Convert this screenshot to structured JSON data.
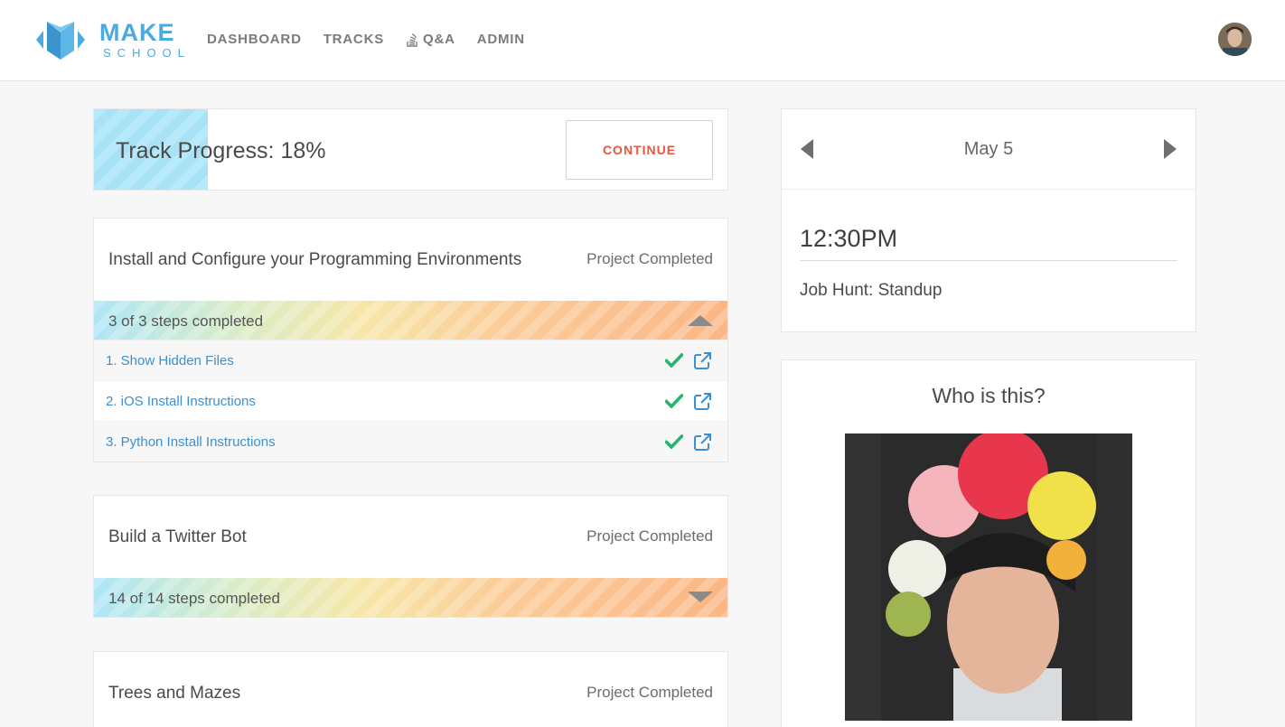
{
  "brand": {
    "make": "MAKE",
    "school": "SCHOOL",
    "color": "#4ea9dd"
  },
  "nav": {
    "items": [
      {
        "label": "DASHBOARD"
      },
      {
        "label": "TRACKS"
      },
      {
        "label": "Q&A",
        "icon": "stack-icon"
      },
      {
        "label": "ADMIN"
      }
    ]
  },
  "progress": {
    "label": "Track Progress: 18%",
    "percent": 18,
    "button": "CONTINUE"
  },
  "projects": [
    {
      "title": "Install and Configure your Programming Environments",
      "status": "Project Completed",
      "steps_text": "3 of 3 steps completed",
      "expanded": true,
      "steps": [
        {
          "label": "1. Show Hidden Files"
        },
        {
          "label": "2. iOS Install Instructions"
        },
        {
          "label": "3. Python Install Instructions"
        }
      ]
    },
    {
      "title": "Build a Twitter Bot",
      "status": "Project Completed",
      "steps_text": "14 of 14 steps completed",
      "expanded": false
    },
    {
      "title": "Trees and Mazes",
      "status": "Project Completed"
    }
  ],
  "calendar": {
    "date": "May 5",
    "event_time": "12:30PM",
    "event_title": "Job Hunt: Standup"
  },
  "who": {
    "title": "Who is this?"
  },
  "colors": {
    "accent": "#e8553e",
    "link": "#3c8fd0",
    "check": "#27b56b"
  }
}
